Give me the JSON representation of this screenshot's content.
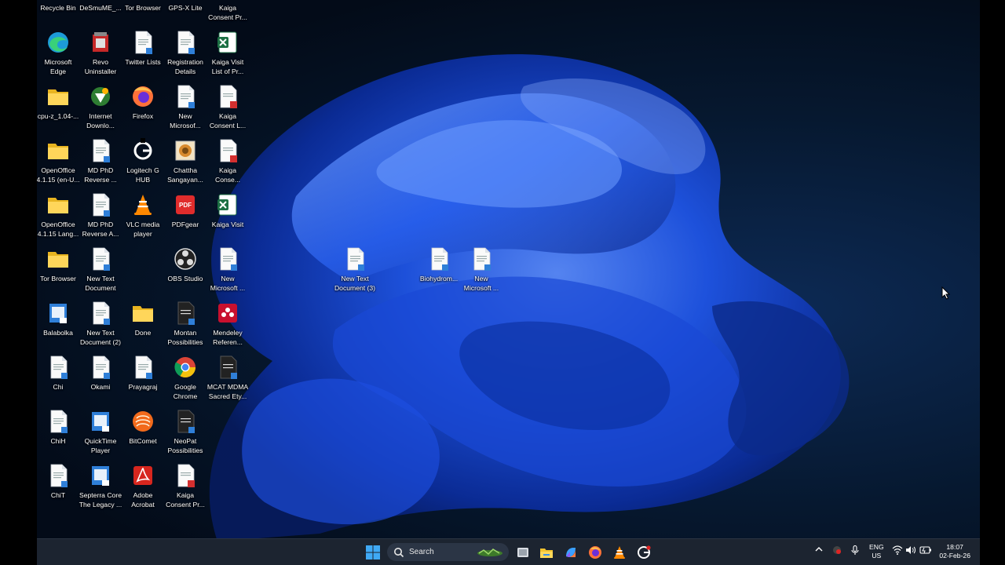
{
  "desktop": {
    "icons": [
      {
        "label": "Recycle Bin",
        "type": "recycle"
      },
      {
        "label": "DeSmuME_...",
        "type": "exe"
      },
      {
        "label": "Tor Browser",
        "type": "tor"
      },
      {
        "label": "GPS-X Lite",
        "type": "exe"
      },
      {
        "label": "Kaiga\nConsent Pr...",
        "type": "doc"
      },
      {
        "label": "Microsoft\nEdge",
        "type": "edge"
      },
      {
        "label": "Revo\nUninstaller",
        "type": "revo"
      },
      {
        "label": "Twitter Lists",
        "type": "doc"
      },
      {
        "label": "Registration\nDetails",
        "type": "doc"
      },
      {
        "label": "Kaiga Visit\nList of Pr...",
        "type": "excel"
      },
      {
        "label": "cpu-z_1.04-...",
        "type": "folder"
      },
      {
        "label": "Internet\nDownlo...",
        "type": "idm"
      },
      {
        "label": "Firefox",
        "type": "firefox"
      },
      {
        "label": "New\nMicrosof...",
        "type": "doc"
      },
      {
        "label": "Kaiga\nConsent L...",
        "type": "pdf"
      },
      {
        "label": "OpenOffice\n4.1.15 (en-U...",
        "type": "folder"
      },
      {
        "label": "MD PhD\nReverse ...",
        "type": "doc"
      },
      {
        "label": "Logitech G\nHUB",
        "type": "logitech"
      },
      {
        "label": "Chattha\nSangayan...",
        "type": "image"
      },
      {
        "label": "Kaiga\nConse...",
        "type": "pdf"
      },
      {
        "label": "OpenOffice\n4.1.15 Lang...",
        "type": "folder"
      },
      {
        "label": "MD PhD\nReverse A...",
        "type": "doc"
      },
      {
        "label": "VLC media\nplayer",
        "type": "vlc"
      },
      {
        "label": "PDFgear",
        "type": "pdfgear"
      },
      {
        "label": "Kaiga Visit",
        "type": "excel"
      },
      {
        "label": "Tor Browser",
        "type": "folder"
      },
      {
        "label": "New Text\nDocument",
        "type": "doc"
      },
      {
        "label": "OBS Studio",
        "type": "obs"
      },
      {
        "label": "New\nMicrosoft ...",
        "type": "doc"
      },
      {
        "label": "Balabolka",
        "type": "app"
      },
      {
        "label": "New Text\nDocument (2)",
        "type": "doc"
      },
      {
        "label": "Done",
        "type": "folder"
      },
      {
        "label": "Montan\nPossibilities",
        "type": "dark"
      },
      {
        "label": "Mendeley\nReferen...",
        "type": "mendeley"
      },
      {
        "label": "Chi",
        "type": "doc"
      },
      {
        "label": "Okami",
        "type": "doc"
      },
      {
        "label": "Prayagraj",
        "type": "doc"
      },
      {
        "label": "Google\nChrome",
        "type": "chrome"
      },
      {
        "label": "MCAT MDMA\nSacred Ety...",
        "type": "dark"
      },
      {
        "label": "ChiH",
        "type": "doc"
      },
      {
        "label": "QuickTime\nPlayer",
        "type": "app"
      },
      {
        "label": "BitComet",
        "type": "bitcomet"
      },
      {
        "label": "NeoPat\nPossibilities",
        "type": "dark"
      },
      {
        "label": "ChiT",
        "type": "doc"
      },
      {
        "label": "Septerra Core\nThe Legacy ...",
        "type": "app"
      },
      {
        "label": "Adobe\nAcrobat",
        "type": "acrobat"
      },
      {
        "label": "Kaiga\nConsent Pr...",
        "type": "pdf"
      },
      {
        "label": "New Text\nDocument (3)",
        "type": "doc"
      },
      {
        "label": "Biohydrom...",
        "type": "doc"
      },
      {
        "label": "New\nMicrosoft ...",
        "type": "doc"
      }
    ]
  },
  "taskbar": {
    "search_label": "Search",
    "apps": [
      "start-icon",
      "task-view-icon",
      "file-explorer-icon",
      "copilot-icon",
      "firefox-icon",
      "vlc-icon",
      "logitech-icon"
    ],
    "lang_primary": "ENG",
    "lang_secondary": "US",
    "time": "18:07",
    "date": "02-Feb-26"
  },
  "colors": {
    "taskbar_bg": "#1c2430",
    "wallpaper_blue": "#1a4fe0",
    "folder_yellow": "#f4c430"
  }
}
